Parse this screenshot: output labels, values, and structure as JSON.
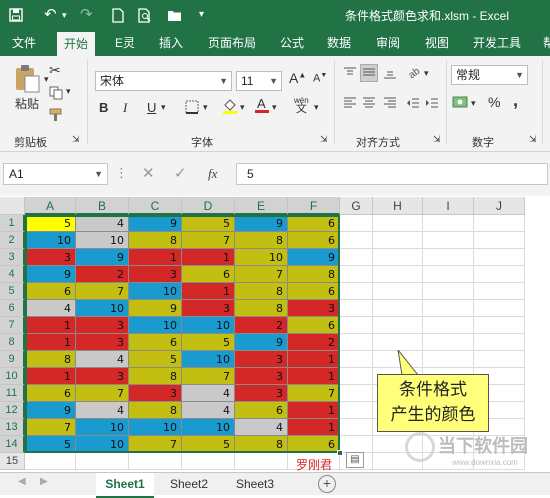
{
  "window": {
    "title": "条件格式颜色求和.xlsm - Excel"
  },
  "tabs": [
    "文件",
    "开始",
    "E灵",
    "插入",
    "页面布局",
    "公式",
    "数据",
    "审阅",
    "视图",
    "开发工具",
    "帮"
  ],
  "ribbon": {
    "paste_label": "粘贴",
    "font_name": "宋体",
    "font_size": "11",
    "bold": "B",
    "italic": "I",
    "underline": "U",
    "grow_font": "A",
    "shrink_font": "A",
    "number_format": "常规",
    "percent": "%",
    "comma": ",",
    "wen": "wén",
    "group_labels": {
      "clipboard": "剪贴板",
      "font": "字体",
      "alignment": "对齐方式",
      "number": "数字"
    }
  },
  "formula_bar": {
    "name_box": "A1",
    "fx": "fx",
    "value": "5"
  },
  "columns": [
    "A",
    "B",
    "C",
    "D",
    "E",
    "F",
    "G",
    "H",
    "I",
    "J"
  ],
  "rows": [
    "1",
    "2",
    "3",
    "4",
    "5",
    "6",
    "7",
    "8",
    "9",
    "10",
    "11",
    "12",
    "13",
    "14",
    "15"
  ],
  "grid": [
    [
      "5",
      "4",
      "9",
      "5",
      "9",
      "6"
    ],
    [
      "10",
      "10",
      "8",
      "7",
      "8",
      "6"
    ],
    [
      "3",
      "9",
      "1",
      "1",
      "10",
      "9"
    ],
    [
      "9",
      "2",
      "3",
      "6",
      "7",
      "8"
    ],
    [
      "6",
      "7",
      "10",
      "1",
      "8",
      "6"
    ],
    [
      "4",
      "10",
      "9",
      "3",
      "8",
      "3"
    ],
    [
      "1",
      "3",
      "10",
      "10",
      "2",
      "6"
    ],
    [
      "1",
      "3",
      "6",
      "5",
      "9",
      "2"
    ],
    [
      "8",
      "4",
      "5",
      "10",
      "3",
      "1"
    ],
    [
      "1",
      "3",
      "8",
      "7",
      "3",
      "1"
    ],
    [
      "6",
      "7",
      "3",
      "4",
      "3",
      "7"
    ],
    [
      "9",
      "4",
      "8",
      "4",
      "6",
      "1"
    ],
    [
      "7",
      "10",
      "10",
      "10",
      "4",
      "1"
    ],
    [
      "5",
      "10",
      "7",
      "5",
      "8",
      "6"
    ]
  ],
  "fills": [
    [
      "yellow",
      "grey",
      "blue",
      "olive",
      "blue",
      "olive"
    ],
    [
      "blue",
      "grey",
      "olive",
      "olive",
      "olive",
      "olive"
    ],
    [
      "red",
      "blue",
      "red",
      "red",
      "olive",
      "blue"
    ],
    [
      "blue",
      "red",
      "red",
      "olive",
      "olive",
      "olive"
    ],
    [
      "olive",
      "olive",
      "blue",
      "red",
      "olive",
      "olive"
    ],
    [
      "grey",
      "blue",
      "olive",
      "red",
      "olive",
      "red"
    ],
    [
      "red",
      "red",
      "blue",
      "blue",
      "red",
      "olive"
    ],
    [
      "red",
      "red",
      "olive",
      "olive",
      "blue",
      "red"
    ],
    [
      "olive",
      "grey",
      "olive",
      "blue",
      "red",
      "red"
    ],
    [
      "red",
      "red",
      "olive",
      "olive",
      "red",
      "red"
    ],
    [
      "olive",
      "olive",
      "red",
      "grey",
      "red",
      "olive"
    ],
    [
      "blue",
      "grey",
      "olive",
      "grey",
      "olive",
      "red"
    ],
    [
      "olive",
      "blue",
      "blue",
      "blue",
      "grey",
      "red"
    ],
    [
      "blue",
      "blue",
      "olive",
      "olive",
      "olive",
      "olive"
    ]
  ],
  "colors": {
    "excel_green": "#217346",
    "red": "#d42727",
    "blue": "#1a9bd0",
    "olive": "#c2be12",
    "grey": "#c9c9c9",
    "yellow": "#ffff00"
  },
  "annotation": {
    "line1": "条件格式",
    "line2": "产生的颜色",
    "author": "罗刚君"
  },
  "sheets": [
    "Sheet1",
    "Sheet2",
    "Sheet3"
  ],
  "watermark": {
    "text": "当下软件园",
    "url": "www.downxia.com"
  }
}
